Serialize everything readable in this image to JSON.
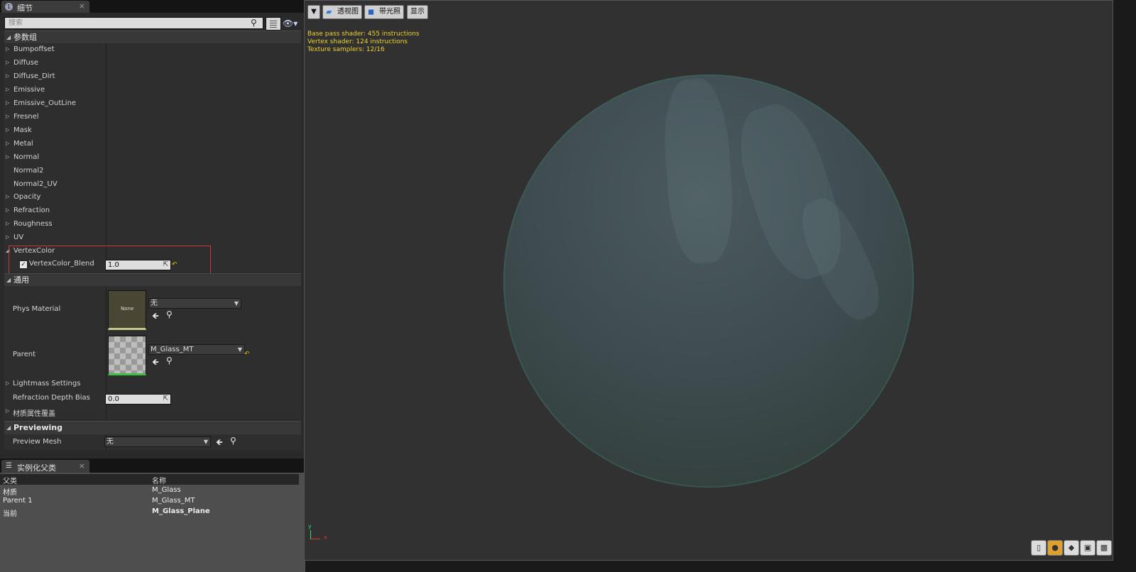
{
  "details": {
    "tab_label": "细节",
    "search_placeholder": "搜索",
    "param_group_label": "参数组",
    "param_items": [
      "Bumpoffset",
      "Diffuse",
      "Diffuse_Dirt",
      "Emissive",
      "Emissive_OutLine",
      "Fresnel",
      "Mask",
      "Metal",
      "Normal",
      "Normal2",
      "Normal2_UV",
      "Opacity",
      "Refraction",
      "Roughness",
      "UV",
      "VertexColor"
    ],
    "vertex_blend": {
      "label": "VertexColor_Blend",
      "value": "1.0",
      "checked": true
    },
    "general_label": "通用",
    "phys_material": {
      "label": "Phys Material",
      "thumb_text": "None",
      "value": "无"
    },
    "parent": {
      "label": "Parent",
      "value": "M_Glass_MT"
    },
    "lightmass_label": "Lightmass Settings",
    "refraction_bias": {
      "label": "Refraction Depth Bias",
      "value": "0.0"
    },
    "override_label": "材质属性覆盖",
    "previewing_label": "Previewing",
    "preview_mesh": {
      "label": "Preview Mesh",
      "value": "无"
    }
  },
  "hierarchy": {
    "tab_label": "实例化父类",
    "col_parent": "父类",
    "col_name": "名称",
    "rows": [
      {
        "parent": "材质",
        "name": "M_Glass"
      },
      {
        "parent": "Parent 1",
        "name": "M_Glass_MT"
      },
      {
        "parent": "当前",
        "name": "M_Glass_Plane"
      }
    ]
  },
  "viewport": {
    "perspective_label": "透视图",
    "lit_label": "带光照",
    "show_label": "显示",
    "stats": [
      "Base pass shader: 455 instructions",
      "Vertex shader: 124 instructions",
      "Texture samplers: 12/16"
    ]
  },
  "colors": {
    "accent_yellow": "#f0d030",
    "highlight_red": "#d03535"
  }
}
